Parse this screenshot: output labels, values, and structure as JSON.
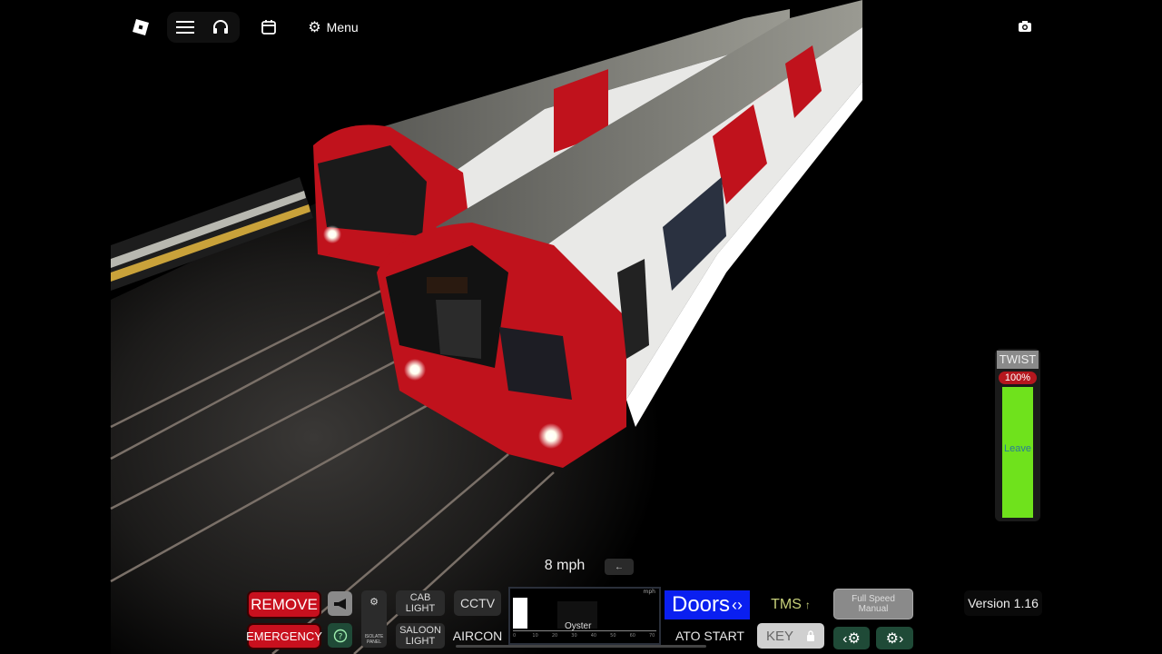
{
  "topbar": {
    "menu_label": "Menu"
  },
  "hud": {
    "speed": "8 mph",
    "direction_glyph": "←",
    "remove_label": "REMOVE",
    "emergency_label": "EMERGENCY",
    "isolate_panel_label": "ISOLATE PANEL",
    "cab_light_label": "CAB LIGHT",
    "saloon_light_label": "SALOON LIGHT",
    "cctv_label": "CCTV",
    "aircon_label": "AIRCON",
    "doors_label": "Doors",
    "doors_arrows": "‹›",
    "tms_label": "TMS",
    "tms_arrow": "↑",
    "ato_start_label": "ATO START",
    "key_label": "KEY",
    "full_speed_manual_label": "Full Speed Manual",
    "version_label": "Version 1.16",
    "oyster_label": "Oyster",
    "speedo_unit": "mph",
    "speedo_ticks": [
      "0",
      "10",
      "20",
      "30",
      "40",
      "50",
      "60",
      "70"
    ],
    "speedo_fill": 0.1
  },
  "twist": {
    "title": "TWIST",
    "percent": "100%",
    "status": "Leave",
    "level": 1.0
  },
  "colors": {
    "train_red": "#c0121c",
    "doors_blue": "#0a1ff0",
    "twist_green": "#6fe21c",
    "tms_yellow": "#c7d07a"
  }
}
